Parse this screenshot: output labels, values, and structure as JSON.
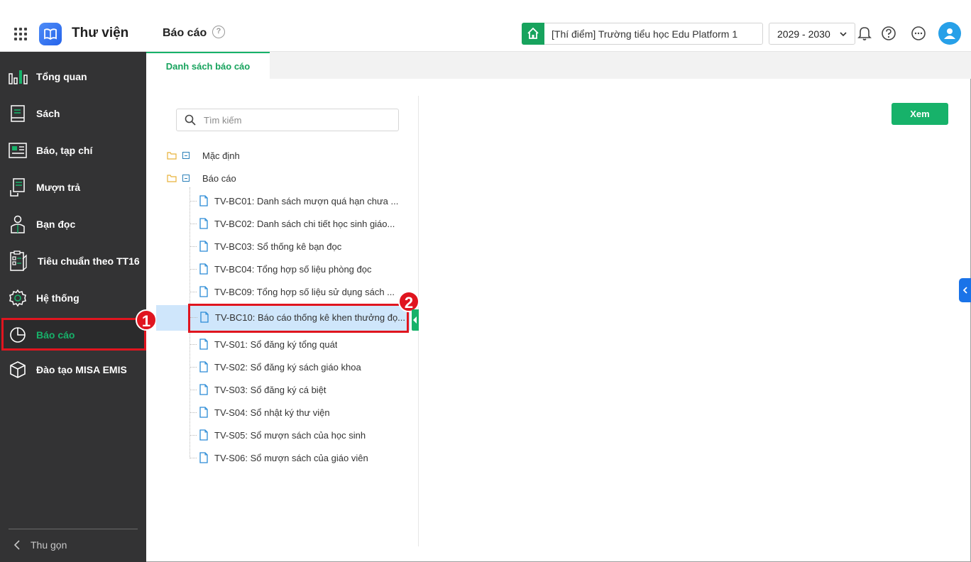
{
  "header": {
    "app_title": "Thư viện",
    "page_title": "Báo cáo",
    "school": "[Thí điểm] Trường tiểu học Edu Platform 1",
    "year": "2029 - 2030"
  },
  "sidebar": {
    "items": [
      {
        "label": "Tổng quan",
        "icon": "chart-bars-icon"
      },
      {
        "label": "Sách",
        "icon": "book-icon"
      },
      {
        "label": "Báo, tạp chí",
        "icon": "newspaper-icon"
      },
      {
        "label": "Mượn trả",
        "icon": "hand-list-icon"
      },
      {
        "label": "Bạn đọc",
        "icon": "reader-icon"
      },
      {
        "label": "Tiêu chuẩn theo TT16",
        "icon": "checklist-icon"
      },
      {
        "label": "Hệ thống",
        "icon": "gear-icon"
      },
      {
        "label": "Báo cáo",
        "icon": "pie-chart-icon",
        "active": true
      },
      {
        "label": "Đào tạo MISA EMIS",
        "icon": "cube-icon"
      }
    ],
    "collapse_label": "Thu gọn",
    "badge_1": "1"
  },
  "tabs": [
    "Danh sách báo cáo"
  ],
  "search": {
    "placeholder": "Tìm kiếm"
  },
  "tree": {
    "groups": [
      "Mặc định",
      "Báo cáo"
    ],
    "reports": [
      "TV-BC01: Danh sách mượn quá hạn chưa ...",
      "TV-BC02: Danh sách chi tiết học sinh giáo...",
      "TV-BC03: Sổ thống kê bạn đọc",
      "TV-BC04: Tổng hợp số liệu phòng đọc",
      "TV-BC09: Tổng hợp số liệu sử dụng sách ...",
      "TV-BC10: Báo cáo thống kê khen thưởng đọ...",
      "TV-S01: Sổ đăng ký tổng quát",
      "TV-S02: Sổ đăng ký sách giáo khoa",
      "TV-S03: Sổ đăng ký cá biệt",
      "TV-S04: Sổ nhật ký thư viện",
      "TV-S05: Sổ mượn sách của học sinh",
      "TV-S06: Sổ mượn sách của giáo viên"
    ],
    "selected_index": 5,
    "badge_2": "2"
  },
  "actions": {
    "view_label": "Xem"
  },
  "colors": {
    "accent": "#17b26a",
    "sidebar_bg": "#333334",
    "highlight": "#e0151f",
    "selected_bg": "#cfe6fb"
  }
}
